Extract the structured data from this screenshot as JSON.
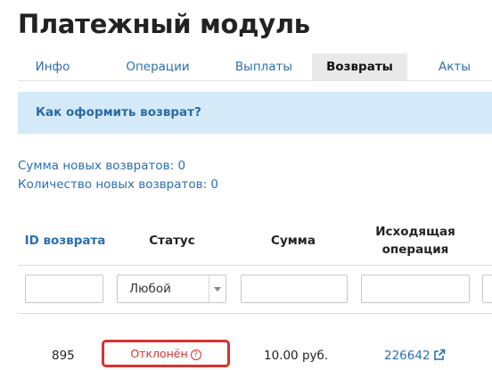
{
  "page": {
    "title": "Платежный модуль"
  },
  "tabs": [
    {
      "label": "Инфо"
    },
    {
      "label": "Операции"
    },
    {
      "label": "Выплаты"
    },
    {
      "label": "Возвраты",
      "active": true
    },
    {
      "label": "Акты"
    }
  ],
  "info": {
    "link": "Как оформить возврат?"
  },
  "stats": {
    "new_refunds_sum": "Сумма новых возвратов: 0",
    "new_refunds_count": "Количество новых возвратов: 0"
  },
  "table": {
    "headers": {
      "id": "ID возврата",
      "status": "Статус",
      "amount": "Сумма",
      "source_op_line1": "Исходящая",
      "source_op_line2": "операция"
    },
    "filters": {
      "status_selected": "Любой"
    },
    "rows": [
      {
        "id": "895",
        "status": "Отклонён",
        "amount": "10.00 руб.",
        "operation": "226642"
      }
    ]
  },
  "colors": {
    "accent": "#2b6fb2",
    "info_bg": "#d4eaf8",
    "status_rejected": "#d9322f",
    "active_tab_bg": "#e9e9e9"
  },
  "icons": {
    "help": "question-circle-icon",
    "external": "external-link-icon",
    "dropdown": "chevron-down-icon"
  }
}
